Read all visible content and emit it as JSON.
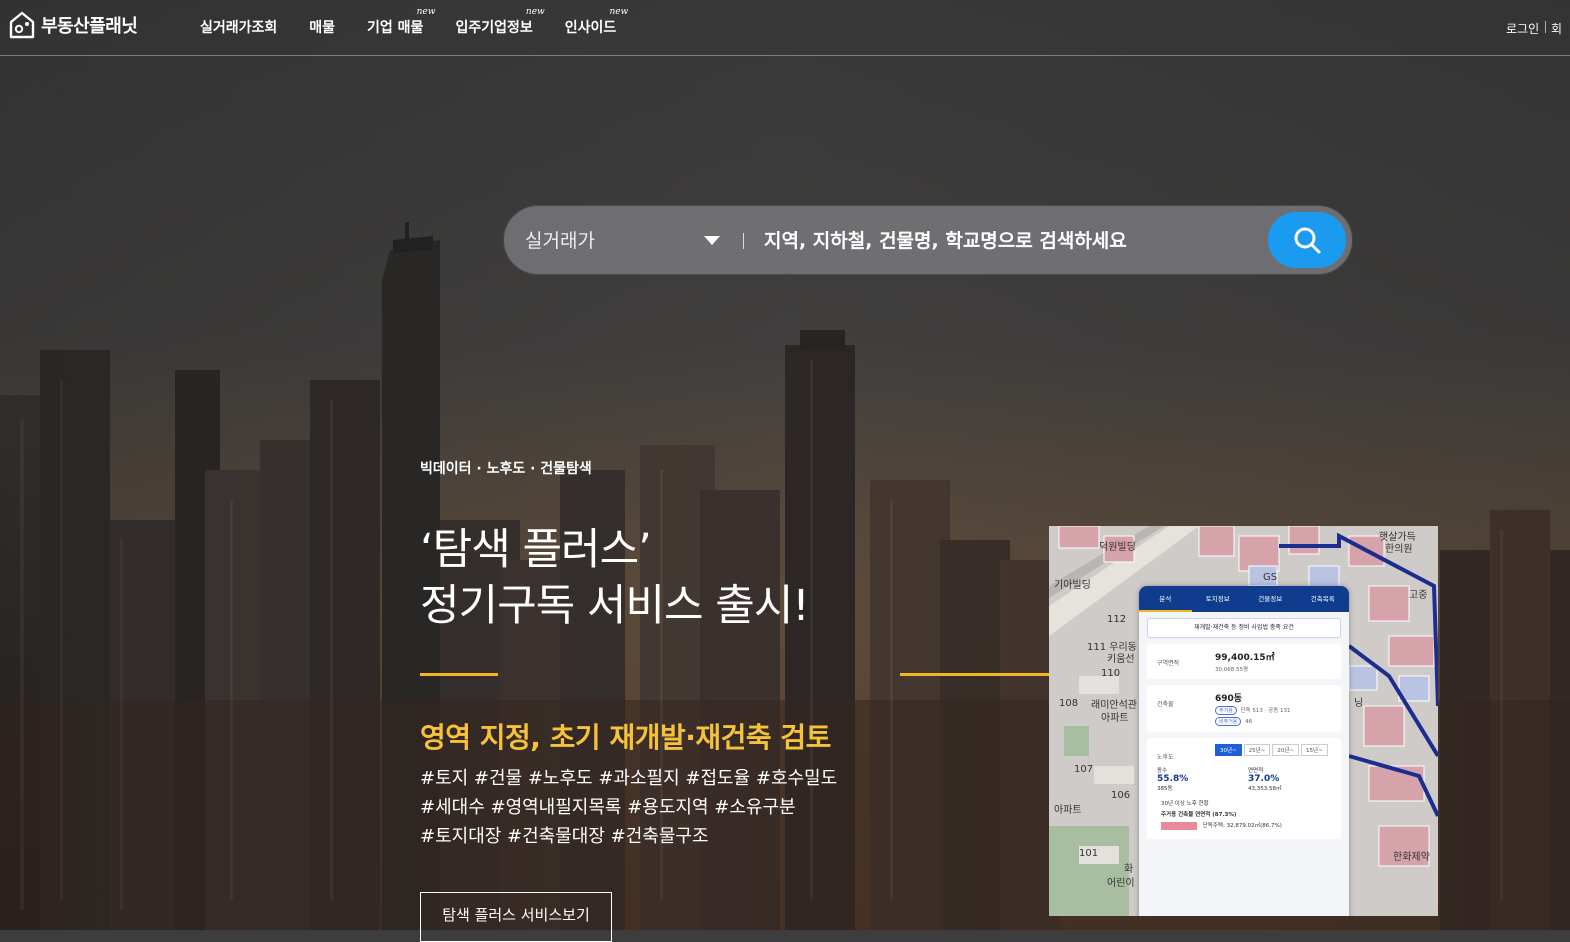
{
  "header": {
    "logo_text": "부동산플래닛",
    "nav": [
      {
        "label": "실거래가조회",
        "badge": ""
      },
      {
        "label": "매물",
        "badge": ""
      },
      {
        "label": "기업 매물",
        "badge": "new"
      },
      {
        "label": "입주기업정보",
        "badge": "new"
      },
      {
        "label": "인사이드",
        "badge": "new"
      }
    ],
    "login_label": "로그인",
    "join_label": "회"
  },
  "search": {
    "type_label": "실거래가",
    "placeholder": "지역, 지하철, 건물명, 학교명으로 검색하세요"
  },
  "hero": {
    "eyebrow": "빅데이터 · 노후도 · 건물탐색",
    "headline_line1": "‘탐색 플러스’",
    "headline_line2": "정기구독 서비스 출시!",
    "subhead": "영역 지정, 초기 재개발·재건축 검토",
    "tags": [
      "#토지 #건물 #노후도 #과소필지 #접도율 #호수밀도",
      "#세대수 #영역내필지목록 #용도지역 #소유구분",
      "#토지대장 #건축물대장 #건축물구조"
    ],
    "cta_label": "탐색 플러스 서비스보기"
  },
  "preview": {
    "map_labels": [
      "덕원빌딩",
      "112",
      "111 우리동",
      "키움선",
      "110",
      "래미안석관",
      "아파트",
      "108",
      "107",
      "106",
      "101",
      "화",
      "어린이",
      "GS",
      "한화제약",
      "기아빌딩",
      "햇살가득",
      "한의원",
      "고중",
      "닝",
      "아파트"
    ],
    "tabs": [
      "분석",
      "토지정보",
      "건물정보",
      "건축목록"
    ],
    "notice": "재개발·재건축 등 정비 사업법 충족 요건",
    "area_label": "구역면적",
    "area_value": "99,400.15㎡",
    "area_sub": "30,068.55평",
    "buildings_label": "건축물",
    "buildings_value": "690동",
    "buildings_chip1": "주거용",
    "buildings_chip1_detail": "단독 513 · 공동 131",
    "buildings_chip2": "비주거용",
    "buildings_chip2_detail": "46",
    "age_label": "노후도",
    "age_tabs": [
      "30년~",
      "25년~",
      "20년~",
      "15년~"
    ],
    "stat1_label": "동수",
    "stat1_value": "55.8%",
    "stat1_sub": "385동",
    "stat2_label": "연면적",
    "stat2_value": "37.0%",
    "stat2_sub": "43,353.58㎡",
    "legend": "30년 이상 노후 현황",
    "residential_title": "주거용 건축물 연면적 (87.3%)",
    "residential_detail": "단독주택: 32,879.02㎡(86.7%)"
  },
  "colors": {
    "accent": "#f2b71f",
    "search_button": "#1a9bf0",
    "phone_header": "#0f3c8c"
  }
}
